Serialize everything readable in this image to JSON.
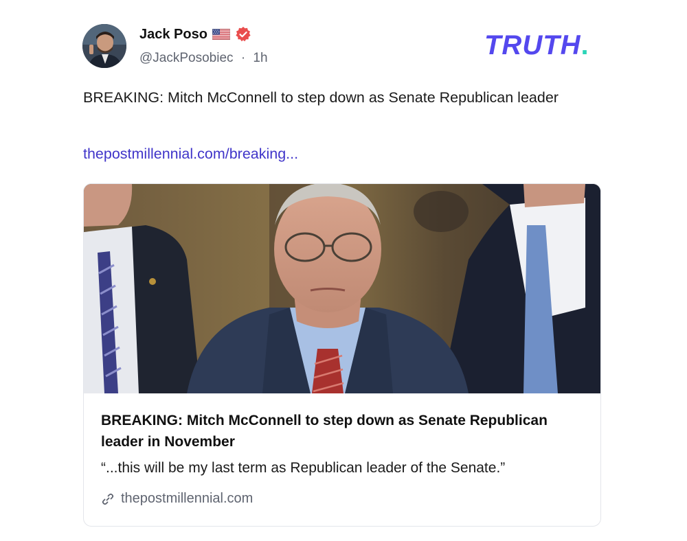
{
  "author": {
    "display_name": "Jack Poso",
    "handle": "@JackPosobiec",
    "separator": "·",
    "time_ago": "1h",
    "flag_icon": "us-flag-icon",
    "verified_icon": "verified-badge-icon",
    "verified_color": "#e94d4d"
  },
  "brand": {
    "logo_text": "TRUTH",
    "logo_dot": ".",
    "logo_color": "#5448ee",
    "dot_color": "#2bd5b8"
  },
  "post": {
    "text": "BREAKING: Mitch McConnell to step down as Senate Republican leader",
    "link_text": "thepostmillennial.com/breaking...",
    "link_color": "#4035c9"
  },
  "link_card": {
    "title": "BREAKING: Mitch McConnell to step down as Senate Republican leader in November",
    "description": "“...this will be my last term as Republican leader of the Senate.”",
    "domain": "thepostmillennial.com",
    "domain_icon": "link-icon"
  }
}
